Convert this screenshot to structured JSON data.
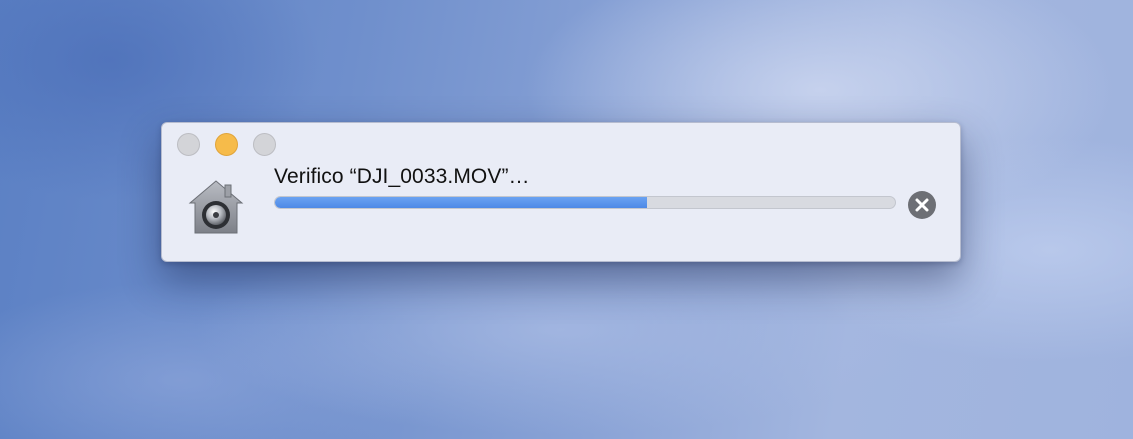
{
  "dialog": {
    "status_text": "Verifico “DJI_0033.MOV”…",
    "progress_fraction": 0.6
  },
  "icons": {
    "app": "gatekeeper-house-icon",
    "stop": "close-circle-icon"
  },
  "colors": {
    "progress_fill": "#4d89e6",
    "progress_track": "#d8dae0",
    "minimize_light": "#f6bb4a",
    "inactive_light": "#d3d4d8",
    "stop_button": "#6d6f75"
  }
}
